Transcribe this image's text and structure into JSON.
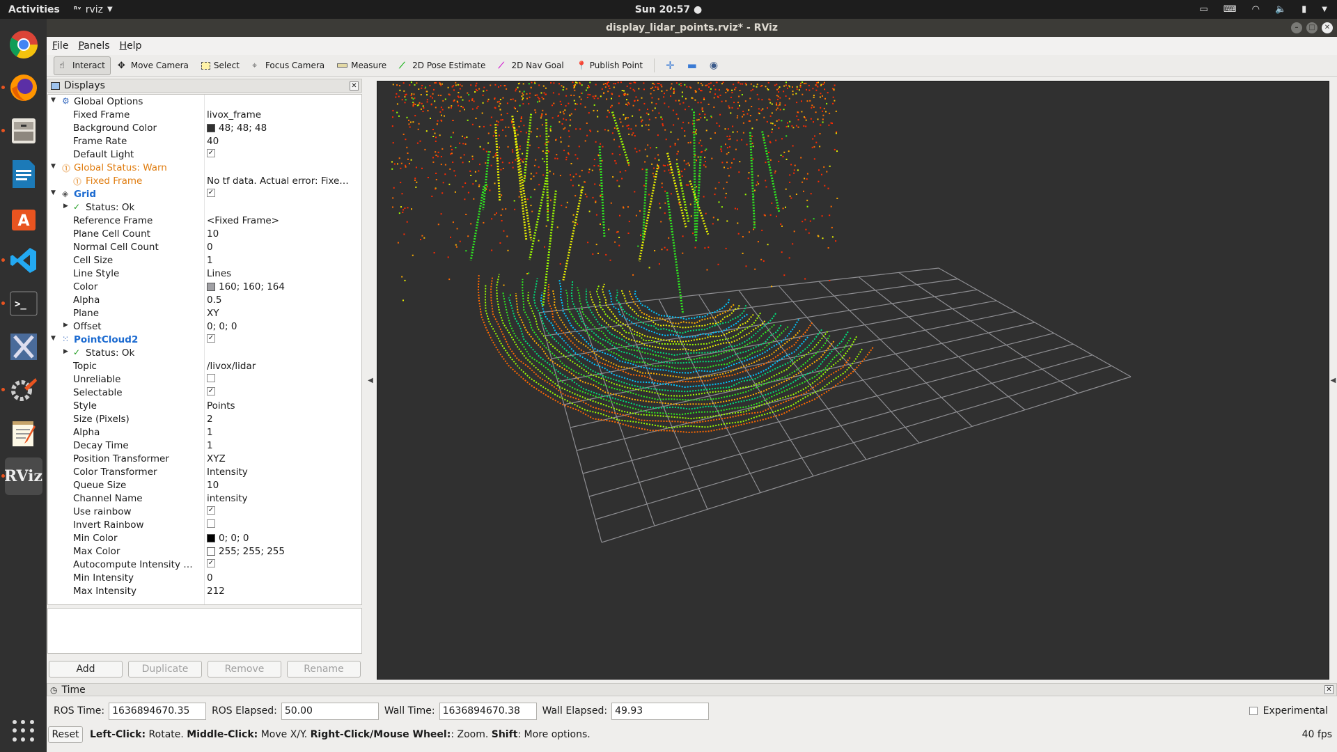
{
  "topbar": {
    "activities": "Activities",
    "app_name": "rviz",
    "clock": "Sun 20:57 ●"
  },
  "window": {
    "title": "display_lidar_points.rviz* - RViz"
  },
  "menu": [
    "File",
    "Panels",
    "Help"
  ],
  "toolbar": {
    "interact": "Interact",
    "move_camera": "Move Camera",
    "select": "Select",
    "focus_camera": "Focus Camera",
    "measure": "Measure",
    "pose_estimate": "2D Pose Estimate",
    "nav_goal": "2D Nav Goal",
    "publish_point": "Publish Point"
  },
  "displays": {
    "title": "Displays",
    "rows": {
      "global_options": "Global Options",
      "fixed_frame_l": "Fixed Frame",
      "fixed_frame_v": "livox_frame",
      "bg_color_l": "Background Color",
      "bg_color_v": "48; 48; 48",
      "frame_rate_l": "Frame Rate",
      "frame_rate_v": "40",
      "default_light_l": "Default Light",
      "global_status": "Global Status: Warn",
      "gs_fixed_frame_l": "Fixed Frame",
      "gs_fixed_frame_v": "No tf data.  Actual error: Fixe…",
      "grid": "Grid",
      "grid_status": "Status: Ok",
      "ref_frame_l": "Reference Frame",
      "ref_frame_v": "<Fixed Frame>",
      "plane_cell_l": "Plane Cell Count",
      "plane_cell_v": "10",
      "normal_cell_l": "Normal Cell Count",
      "normal_cell_v": "0",
      "cell_size_l": "Cell Size",
      "cell_size_v": "1",
      "line_style_l": "Line Style",
      "line_style_v": "Lines",
      "color_l": "Color",
      "color_v": "160; 160; 164",
      "alpha_l": "Alpha",
      "alpha_v": "0.5",
      "plane_l": "Plane",
      "plane_v": "XY",
      "offset_l": "Offset",
      "offset_v": "0; 0; 0",
      "pointcloud": "PointCloud2",
      "pc_status": "Status: Ok",
      "topic_l": "Topic",
      "topic_v": "/livox/lidar",
      "unreliable_l": "Unreliable",
      "selectable_l": "Selectable",
      "style_l": "Style",
      "style_v": "Points",
      "size_l": "Size (Pixels)",
      "size_v": "2",
      "pc_alpha_l": "Alpha",
      "pc_alpha_v": "1",
      "decay_l": "Decay Time",
      "decay_v": "1",
      "pos_tf_l": "Position Transformer",
      "pos_tf_v": "XYZ",
      "col_tf_l": "Color Transformer",
      "col_tf_v": "Intensity",
      "queue_l": "Queue Size",
      "queue_v": "10",
      "channel_l": "Channel Name",
      "channel_v": "intensity",
      "rainbow_l": "Use rainbow",
      "invert_l": "Invert Rainbow",
      "min_color_l": "Min Color",
      "min_color_v": "0; 0; 0",
      "max_color_l": "Max Color",
      "max_color_v": "255; 255; 255",
      "autocompute_l": "Autocompute Intensity …",
      "min_int_l": "Min Intensity",
      "min_int_v": "0",
      "max_int_l": "Max Intensity",
      "max_int_v": "212"
    },
    "buttons": {
      "add": "Add",
      "duplicate": "Duplicate",
      "remove": "Remove",
      "rename": "Rename"
    }
  },
  "time": {
    "title": "Time",
    "ros_time_l": "ROS Time:",
    "ros_time_v": "1636894670.35",
    "ros_elapsed_l": "ROS Elapsed:",
    "ros_elapsed_v": "50.00",
    "wall_time_l": "Wall Time:",
    "wall_time_v": "1636894670.38",
    "wall_elapsed_l": "Wall Elapsed:",
    "wall_elapsed_v": "49.93",
    "experimental": "Experimental",
    "reset": "Reset",
    "hint_left_b": "Left-Click:",
    "hint_left": " Rotate. ",
    "hint_mid_b": "Middle-Click:",
    "hint_mid": " Move X/Y. ",
    "hint_right_b": "Right-Click/Mouse Wheel:",
    "hint_right": ": Zoom. ",
    "hint_shift_b": "Shift",
    "hint_shift": ": More options.",
    "fps": "40 fps"
  },
  "colors": {
    "background": "#303030",
    "grid": "#a0a0a4",
    "warn": "#e07d10",
    "link_blue": "#1b6ad0"
  }
}
